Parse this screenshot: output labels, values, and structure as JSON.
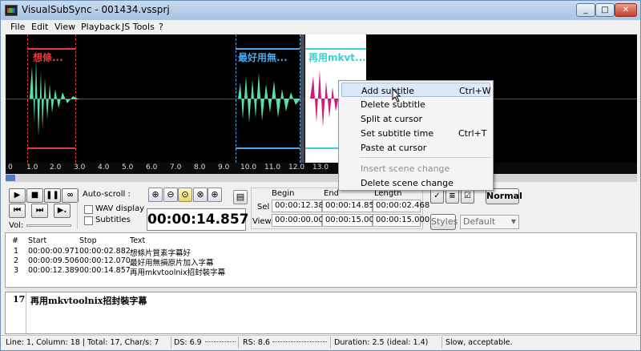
{
  "window": {
    "title": "VisualSubSync - 001434.vssprj",
    "min": "_",
    "max": "□",
    "close": "✕"
  },
  "menu": [
    "File",
    "Edit",
    "View",
    "Playback",
    "JS Tools",
    "?"
  ],
  "waveform": {
    "subtitles": [
      {
        "label": "想條...",
        "color": "#e43c3c"
      },
      {
        "label": "最好用無...",
        "color": "#4aa8f0"
      },
      {
        "label": "再用mkvt...",
        "color": "#32d2d8"
      }
    ],
    "ruler_ticks": [
      "0",
      "1.0",
      "2.0",
      "3.0",
      "4.0",
      "5.0",
      "6.0",
      "7.0",
      "8.0",
      "9.0",
      "10.0",
      "11.0",
      "12.0",
      "13.0"
    ]
  },
  "context_menu": {
    "items": [
      {
        "label": "Add subtitle",
        "shortcut": "Ctrl+W",
        "highlighted": true,
        "enabled": true
      },
      {
        "label": "Delete subtitle",
        "shortcut": "",
        "enabled": true
      },
      {
        "label": "Split at cursor",
        "shortcut": "",
        "enabled": true
      },
      {
        "label": "Set subtitle time",
        "shortcut": "Ctrl+T",
        "enabled": true
      },
      {
        "label": "Paste at cursor",
        "shortcut": "",
        "enabled": true
      },
      {
        "label": "Insert scene change",
        "shortcut": "",
        "enabled": false
      },
      {
        "label": "Delete scene change",
        "shortcut": "",
        "enabled": true
      }
    ]
  },
  "playback": {
    "play": "▶",
    "stop": "■",
    "pause": "❚❚",
    "loop": "∞",
    "prev": "⏮",
    "next": "⏭",
    "step": "▶.",
    "vol_label": "Vol:"
  },
  "autoscroll": {
    "label": "Auto-scroll :",
    "wav_display": "WAV display",
    "subtitles": "Subtitles"
  },
  "time_display": "00:00:14.857",
  "timing": {
    "headers": [
      "Begin",
      "End",
      "Length"
    ],
    "rows": [
      {
        "label": "Sel",
        "begin": "00:00:12.389",
        "end": "00:00:14.857",
        "length": "00:00:02.468"
      },
      {
        "label": "View",
        "begin": "00:00:00.000",
        "end": "00:00:15.000",
        "length": "00:00:15.000"
      }
    ]
  },
  "style": {
    "normal_button": "Normal",
    "styles_button": "Styles",
    "style_select": "Default"
  },
  "list": {
    "headers": [
      "#",
      "Start",
      "Stop",
      "Text"
    ],
    "rows": [
      [
        "1",
        "00:00:00.971",
        "00:00:02.882",
        "想條片質素字幕好"
      ],
      [
        "2",
        "00:00:09.506",
        "00:00:12.070",
        "最好用無損原片加入字幕"
      ],
      [
        "3",
        "00:00:12.389",
        "00:00:14.857",
        "再用mkvtoolnix招封裝字幕"
      ]
    ]
  },
  "editor": {
    "number": "17",
    "text": "再用mkvtoolnix招封裝字幕"
  },
  "status": {
    "position": "Line: 1, Column: 18 | Total: 17, Char/s: 7",
    "ds": "DS: 6.9",
    "rs": "RS: 8.6",
    "duration": "Duration: 2.5 (ideal: 1.4)",
    "quality": "Slow, acceptable."
  }
}
